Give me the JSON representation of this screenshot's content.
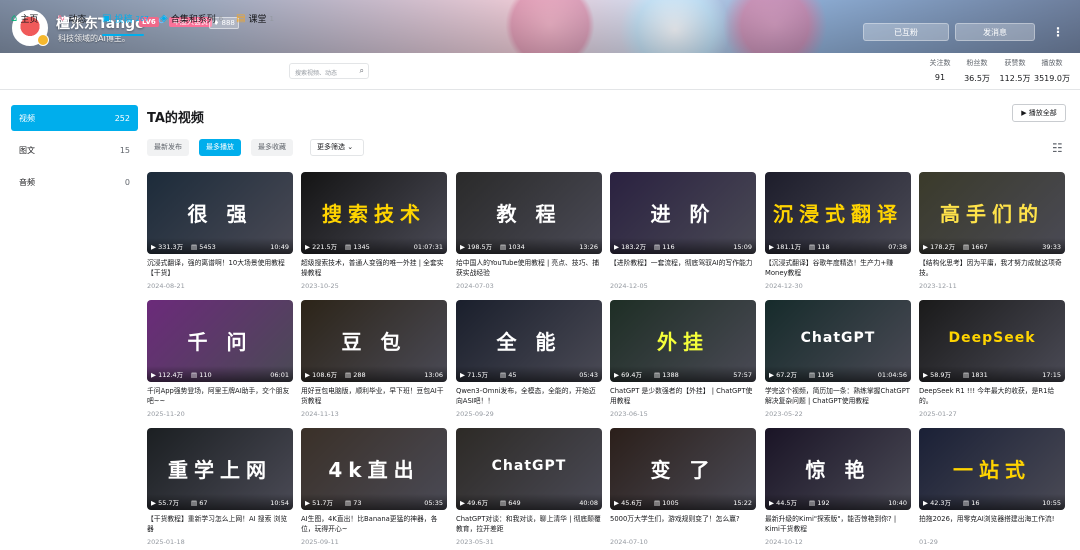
{
  "header": {
    "username": "檀东东Tango",
    "level": "LV6",
    "gender_icon": "♂",
    "vip_badge": "年度大会员",
    "medal": "♦ 888",
    "signature": "科技领域的AI博主。",
    "followed_label": "已互粉",
    "message_label": "发消息",
    "more_icon": "more-dots-icon"
  },
  "nav": {
    "tabs": [
      {
        "icon": "⌂",
        "label": "主页",
        "count": ""
      },
      {
        "icon": "∿",
        "label": "动态",
        "count": ""
      },
      {
        "icon": "▣",
        "label": "投稿",
        "count": "267"
      },
      {
        "icon": "◈",
        "label": "合集和系列",
        "count": "6"
      },
      {
        "icon": "▤",
        "label": "课堂",
        "count": "1"
      }
    ],
    "search_placeholder": "搜索视频、动态",
    "stats": [
      {
        "label": "关注数",
        "value": "91"
      },
      {
        "label": "粉丝数",
        "value": "36.5万"
      },
      {
        "label": "获赞数",
        "value": "112.5万"
      },
      {
        "label": "播放数",
        "value": "3519.0万"
      }
    ]
  },
  "sidebar": {
    "items": [
      {
        "label": "视频",
        "count": "252"
      },
      {
        "label": "图文",
        "count": "15"
      },
      {
        "label": "音频",
        "count": "0"
      }
    ]
  },
  "main": {
    "title": "TA的视频",
    "play_all": "▶ 播放全部",
    "filters": [
      "最新发布",
      "最多播放",
      "最多收藏"
    ],
    "more_filter": "更多筛选 ⌄",
    "videos": [
      {
        "title": "沉浸式翻译，强的离谱啊！10大场景使用教程【干货】",
        "date": "2024-08-21",
        "views": "331.3万",
        "danmaku": "5453",
        "duration": "10:49",
        "cover": "很 强",
        "bg": "#1c2b3a",
        "fg": "#ffffff"
      },
      {
        "title": "超级搜索技术，普通人变强的唯一外挂 | 全套实操教程",
        "date": "2023-10-25",
        "views": "221.5万",
        "danmaku": "1345",
        "duration": "01:07:31",
        "cover": "搜索技术",
        "bg": "#141414",
        "fg": "#ffd400"
      },
      {
        "title": "给中国人的YouTube使用教程 | 亮点、技巧、捕获实战经验",
        "date": "2024-07-03",
        "views": "198.5万",
        "danmaku": "1034",
        "duration": "13:26",
        "cover": "教 程",
        "bg": "#2a2a2a",
        "fg": "#ffffff"
      },
      {
        "title": "【进阶教程】一套流程，彻底驾驭AI的写作能力",
        "date": "2024-12-05",
        "views": "183.2万",
        "danmaku": "116",
        "duration": "15:09",
        "cover": "进 阶",
        "bg": "#2a2140",
        "fg": "#ffffff"
      },
      {
        "title": "【沉浸式翻译】谷歌年度精选！生产力+赚Money教程",
        "date": "2024-12-30",
        "views": "181.1万",
        "danmaku": "118",
        "duration": "07:38",
        "cover": "沉浸式翻译",
        "bg": "#1d1d2b",
        "fg": "#ffd400"
      },
      {
        "title": "【结构化思考】因为平庸，我才努力成就这项奇技。",
        "date": "2023-12-11",
        "views": "178.2万",
        "danmaku": "1667",
        "duration": "39:33",
        "cover": "高手们的",
        "bg": "#3a3a2a",
        "fg": "#ffe34a"
      },
      {
        "title": "千问App强势登场，阿里王牌AI助手，交个朋友吧~~",
        "date": "2025-11-20",
        "views": "112.4万",
        "danmaku": "110",
        "duration": "06:01",
        "cover": "千 问",
        "bg": "#6b2a7a",
        "fg": "#ffffff"
      },
      {
        "title": "用好豆包电脑版，顺利毕业，早下班！豆包AI干货教程",
        "date": "2024-11-13",
        "views": "108.6万",
        "danmaku": "288",
        "duration": "13:06",
        "cover": "豆 包",
        "bg": "#2c2418",
        "fg": "#ffffff"
      },
      {
        "title": "Qwen3-Omni发布，全模态，全能的，开始迈向ASI吧！！",
        "date": "2025-09-29",
        "views": "71.5万",
        "danmaku": "45",
        "duration": "05:43",
        "cover": "全 能",
        "bg": "#1a1f2c",
        "fg": "#ffffff"
      },
      {
        "title": "ChatGPT 是少数强者的【外挂】 | ChatGPT使用教程",
        "date": "2023-06-15",
        "views": "69.4万",
        "danmaku": "1388",
        "duration": "57:57",
        "cover": "外挂",
        "bg": "#1e2e25",
        "fg": "#f5ff3a"
      },
      {
        "title": "学完这个视频，简历加一条：熟练掌握ChatGPT解决复杂问题 | ChatGPT使用教程",
        "date": "2023-05-22",
        "views": "67.2万",
        "danmaku": "1195",
        "duration": "01:04:56",
        "cover": "ChatGPT",
        "bg": "#162b2b",
        "fg": "#ffffff"
      },
      {
        "title": "DeepSeek R1 !!! 今年最大的收获，是R1给的。",
        "date": "2025-01-27",
        "views": "58.9万",
        "danmaku": "1831",
        "duration": "17:15",
        "cover": "DeepSeek",
        "bg": "#1a1a1a",
        "fg": "#ffd400"
      },
      {
        "title": "【干货教程】重新学习怎么上网！AI 搜索 浏览器",
        "date": "2025-01-18",
        "views": "55.7万",
        "danmaku": "67",
        "duration": "10:54",
        "cover": "重学上网",
        "bg": "#1b1f22",
        "fg": "#ffffff"
      },
      {
        "title": "AI生图，4K直出！比Banana更猛的神器，各位，玩得开心~",
        "date": "2025-09-11",
        "views": "51.7万",
        "danmaku": "73",
        "duration": "05:35",
        "cover": "4k直出",
        "bg": "#3a3028",
        "fg": "#ffffff"
      },
      {
        "title": "ChatGPT对谈：和我对谈，聊上清华 | 彻底颠覆教育，拉开差距",
        "date": "2023-05-31",
        "views": "49.6万",
        "danmaku": "649",
        "duration": "40:08",
        "cover": "ChatGPT",
        "bg": "#2d2a26",
        "fg": "#ffffff"
      },
      {
        "title": "5000万大学生们，游戏规则变了！怎么赢?",
        "date": "2024-07-10",
        "views": "45.6万",
        "danmaku": "1005",
        "duration": "15:22",
        "cover": "变 了",
        "bg": "#2b1f1a",
        "fg": "#ffffff"
      },
      {
        "title": "最新升级的Kimi\"探索版\"，能否惊艳到你? | Kimi干货教程",
        "date": "2024-10-12",
        "views": "44.5万",
        "danmaku": "192",
        "duration": "10:40",
        "cover": "惊 艳",
        "bg": "#1a1426",
        "fg": "#ffffff"
      },
      {
        "title": "拍拖2026，用零克AI浏览器搭建出海工作流!",
        "date": "01-29",
        "views": "42.3万",
        "danmaku": "16",
        "duration": "10:55",
        "cover": "一站式",
        "bg": "#1a2036",
        "fg": "#ffd400"
      }
    ]
  }
}
